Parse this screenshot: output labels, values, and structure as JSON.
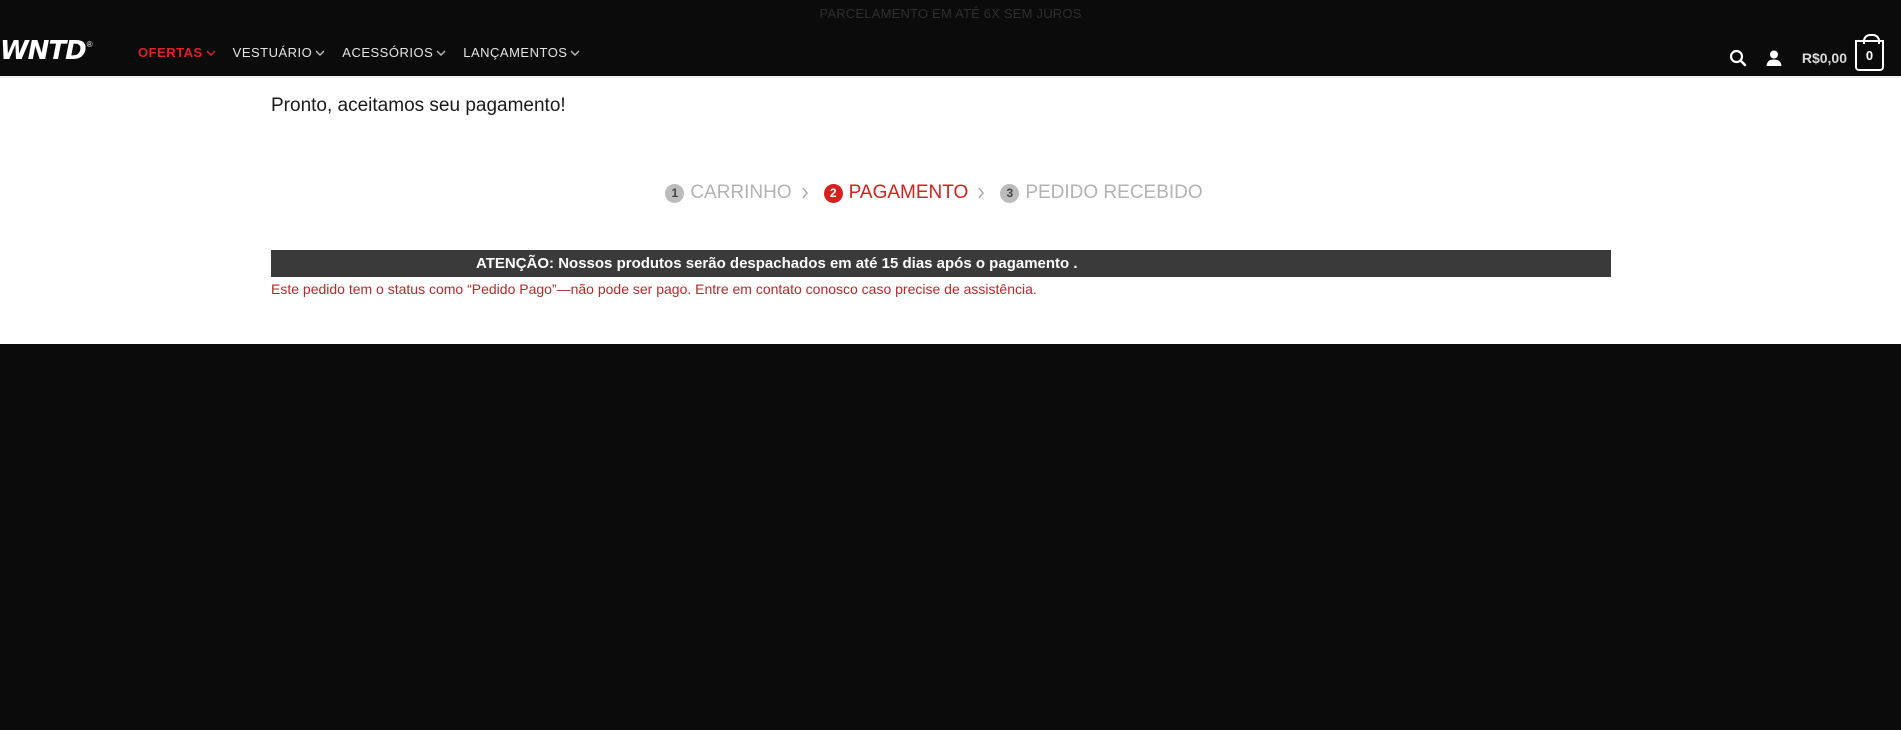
{
  "topbar": {
    "promo_text": "PARCELAMENTO EM ATÉ 6X SEM JUROS"
  },
  "brand": {
    "logo_text": "WNTD",
    "logo_mark": "®"
  },
  "nav": {
    "items": [
      {
        "label": "OFERTAS",
        "active": true
      },
      {
        "label": "VESTUÁRIO",
        "active": false
      },
      {
        "label": "ACESSÓRIOS",
        "active": false
      },
      {
        "label": "LANÇAMENTOS",
        "active": false
      }
    ]
  },
  "header": {
    "search_icon": "search-icon",
    "account_icon": "user-icon",
    "cart_total": "R$0,00",
    "cart_count": "0"
  },
  "page": {
    "confirmation": "Pronto, aceitamos seu pagamento!",
    "steps": [
      {
        "number": "1",
        "label": "CARRINHO",
        "active": false
      },
      {
        "number": "2",
        "label": "PAGAMENTO",
        "active": true
      },
      {
        "number": "3",
        "label": "PEDIDO RECEBIDO",
        "active": false
      }
    ],
    "notice": "ATENÇÃO: Nossos produtos serão despachados em até 15 dias após o pagamento .",
    "status_message": "Este pedido tem o status como “Pedido Pago”—não pode ser pago. Entre em contato conosco caso precise de assistência."
  },
  "colors": {
    "accent_red": "#e3202a",
    "background_dark": "#0b0b0b",
    "notice_bar": "#3a3a3a"
  }
}
